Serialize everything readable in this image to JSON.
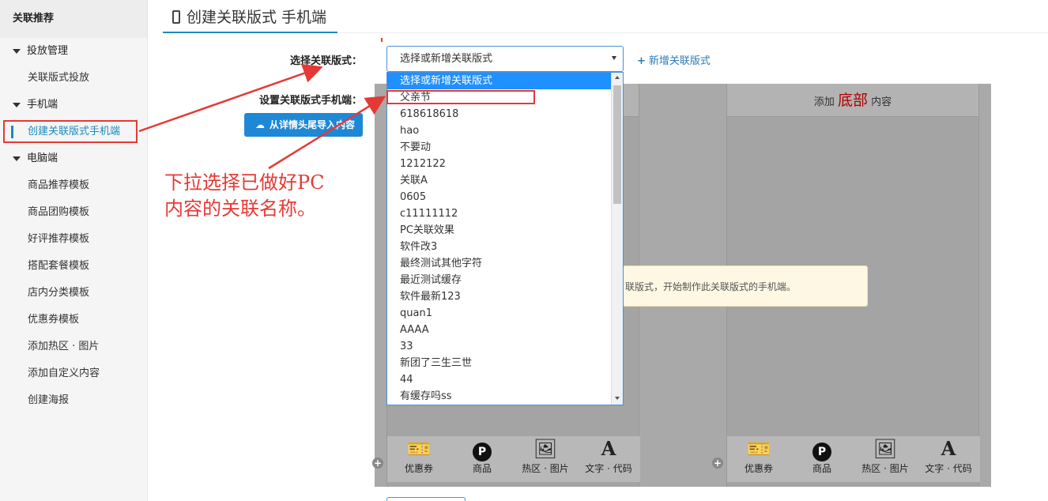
{
  "sidebar": {
    "title": "关联推荐",
    "groups": [
      {
        "label": "投放管理",
        "items": [
          "关联版式投放"
        ]
      },
      {
        "label": "手机端",
        "items": [
          "创建关联版式手机端"
        ]
      },
      {
        "label": "电脑端",
        "items": [
          "商品推荐模板",
          "商品团购模板",
          "好评推荐模板",
          "搭配套餐模板",
          "店内分类模板",
          "优惠券模板",
          "添加热区 · 图片",
          "添加自定义内容",
          "创建海报"
        ]
      }
    ]
  },
  "header": {
    "title": "创建关联版式 手机端"
  },
  "form": {
    "select_label": "选择关联版式：",
    "select_value": "选择或新增关联版式",
    "add_link": "新增关联版式",
    "setting_label": "设置关联版式手机端：",
    "import_button": "从详情头尾导入内容"
  },
  "dropdown": {
    "options": [
      "选择或新增关联版式",
      "父亲节",
      "618618618",
      "hao",
      "不要动",
      "1212122",
      "关联A",
      "0605",
      "c11111112",
      "PC关联效果",
      "软件改3",
      "最终测试其他字符",
      "最近测试缓存",
      "软件最新123",
      "quan1",
      "AAAA",
      "33",
      "新团了三生三世",
      "44",
      "有缓存吗ss"
    ]
  },
  "panels": {
    "right_head_prefix": "添加",
    "right_head_big": "底部",
    "right_head_suffix": "内容",
    "notice": "联版式，开始制作此关联版式的手机端。",
    "tools": [
      {
        "icon": "coupon-icon",
        "label": "优惠券"
      },
      {
        "icon": "product-icon",
        "label": "商品"
      },
      {
        "icon": "image-icon",
        "label": "热区 · 图片"
      },
      {
        "icon": "text-icon",
        "label": "文字 · 代码"
      }
    ]
  },
  "annotation": {
    "line1": "下拉选择已做好PC",
    "line2": "内容的关联名称。"
  },
  "colors": {
    "accent": "#1a8bbd",
    "annotation": "#e53935",
    "button": "#1e88d6"
  }
}
